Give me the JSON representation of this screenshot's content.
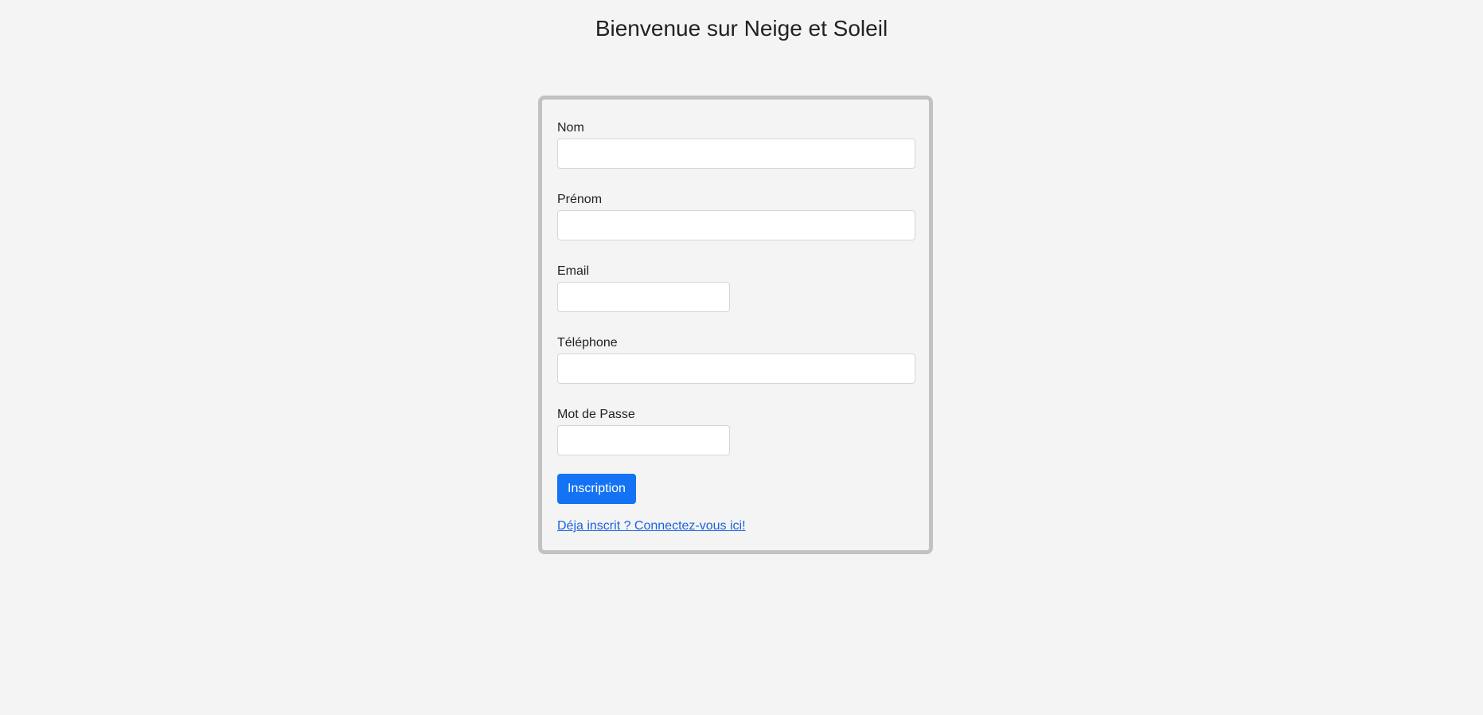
{
  "page": {
    "title": "Bienvenue sur Neige et Soleil"
  },
  "form": {
    "fields": [
      {
        "label": "Nom",
        "value": "",
        "placeholder": ""
      },
      {
        "label": "Prénom",
        "value": "",
        "placeholder": ""
      },
      {
        "label": "Email",
        "value": "",
        "placeholder": ""
      },
      {
        "label": "Téléphone",
        "value": "",
        "placeholder": ""
      },
      {
        "label": "Mot de Passe",
        "value": "",
        "placeholder": ""
      }
    ],
    "submit_label": "Inscription",
    "login_link": "Déja inscrit ? Connectez-vous ici!"
  },
  "colors": {
    "background": "#f4f4f4",
    "card_border": "#c3c1c2",
    "primary_button": "#1473f4",
    "link": "#1a62e0"
  }
}
